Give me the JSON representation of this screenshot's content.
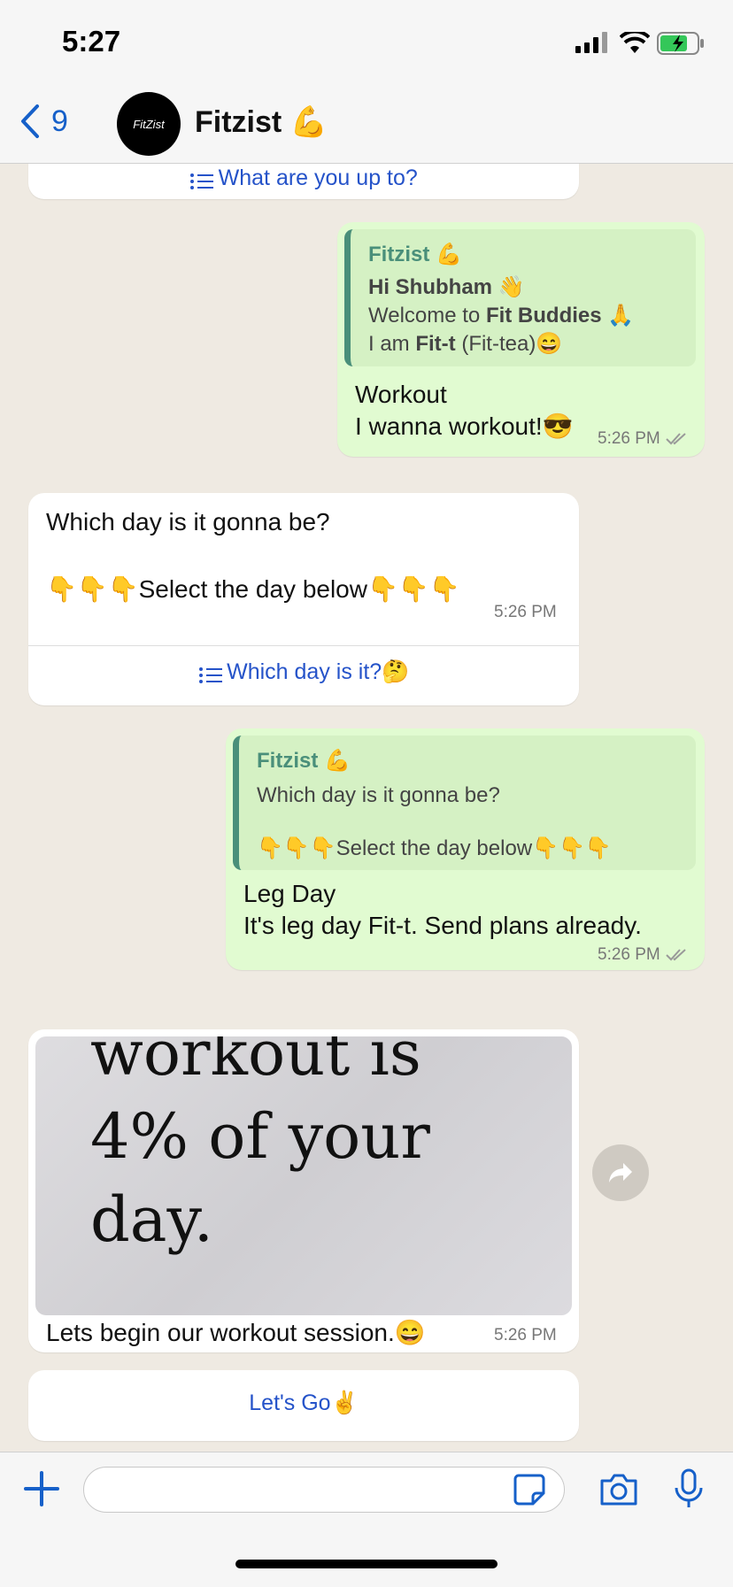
{
  "status_bar": {
    "time": "5:27"
  },
  "header": {
    "back_count": "9",
    "avatar_text": "FitZist",
    "name": "Fitzist 💪"
  },
  "messages": {
    "m0": {
      "list_button": "What are you up to?"
    },
    "m1": {
      "quote_author": "Fitzist 💪",
      "quote_line1": "Hi Shubham 👋",
      "quote_line2_prefix": "Welcome to ",
      "quote_line2_bold": "Fit Buddies",
      "quote_line2_suffix": " 🙏",
      "quote_line3_prefix": "I am ",
      "quote_line3_bold": "Fit-t",
      "quote_line3_suffix": " (Fit-tea)😄",
      "line1": "Workout",
      "line2": "I wanna workout!😎",
      "time": "5:26 PM"
    },
    "m2": {
      "line1": "Which day is it gonna be?",
      "line2": "👇👇👇Select the day below👇👇👇",
      "time": "5:26 PM",
      "list_button": "Which day is it?🤔"
    },
    "m3": {
      "quote_author": "Fitzist 💪",
      "quote_line1": "Which day is it gonna be?",
      "quote_line2": "👇👇👇Select the day below👇👇👇",
      "line1": "Leg Day",
      "line2": "It's leg day Fit-t. Send plans already.",
      "time": "5:26 PM"
    },
    "m4": {
      "image_line1": "workout is",
      "image_line2": "4% of your",
      "image_line3": "day.",
      "caption": "Lets begin our workout session.😄",
      "time": "5:26 PM",
      "button": "Let's Go✌️"
    }
  },
  "composer": {
    "placeholder": ""
  },
  "icons": {
    "back": "chevron-left-icon",
    "forward": "forward-icon",
    "plus": "plus-icon",
    "sticker": "sticker-icon",
    "camera": "camera-icon",
    "mic": "microphone-icon",
    "read": "double-check-icon",
    "list": "list-icon"
  },
  "colors": {
    "accent": "#1660c9",
    "outgoing_bubble": "#e1fbd1",
    "quote_bar": "#4a8f7a"
  }
}
